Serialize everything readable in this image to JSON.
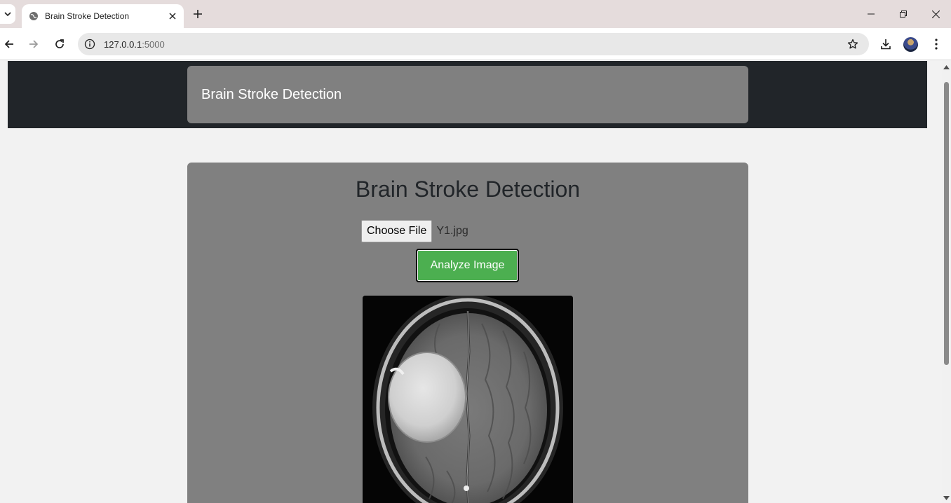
{
  "browser": {
    "tab_title": "Brain Stroke Detection",
    "url_host": "127.0.0.1",
    "url_port": ":5000"
  },
  "navbar": {
    "brand": "Brain Stroke Detection"
  },
  "main": {
    "heading": "Brain Stroke Detection",
    "choose_file_label": "Choose File",
    "selected_file": "Y1.jpg",
    "analyze_label": "Analyze Image"
  },
  "colors": {
    "navbar_bg": "#212529",
    "card_bg": "#808080",
    "analyze_button": "#4caf50"
  }
}
